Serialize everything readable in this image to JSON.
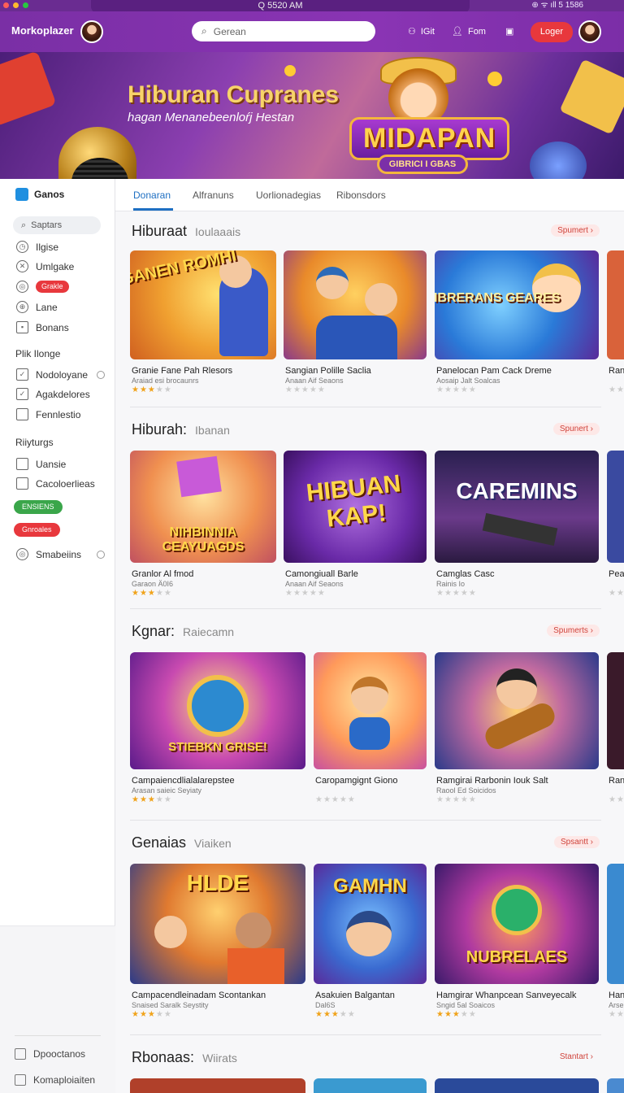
{
  "colors": {
    "brand_purple": "#7a2fa5",
    "accent_red": "#e8383d",
    "tab_blue": "#1e6fc2",
    "star": "#f0a31b"
  },
  "system": {
    "clock": "Q 5520 AM",
    "status": "⊕ ᯤ ıll 5 1586"
  },
  "header": {
    "brand": "Morkoplazer",
    "search_placeholder": "Gerean",
    "link_1": "IGit",
    "link_2": "Fom",
    "login": "Loger"
  },
  "hero": {
    "title": "Hiburan Cupranes",
    "subtitle": "hagan Menanebeenloŕj Hestan",
    "logo": "MIDAPAN",
    "badge": "GIBRICI I GBAS"
  },
  "sidebar": {
    "heading": "Ganos",
    "search": "Saptars",
    "items": [
      "Ilgise",
      "Umlgake",
      "Grakle",
      "Lane",
      "Bonans"
    ],
    "group_1": "Plik Ilonge",
    "group_1_items": [
      "Nodoloyane",
      "Agakdelores",
      "Fennlestio"
    ],
    "group_2": "Riiyturgs",
    "group_2_items": [
      "Uansie",
      "Cacoloerlieas"
    ],
    "pill_green": "ENSIENS",
    "pill_red": "Gnroales",
    "last_item": "Smabeiins",
    "footer": [
      "Dpooctanos",
      "Komaploiaiten"
    ]
  },
  "tabs": [
    "Donaran",
    "Alfranuns",
    "Uorlionadegias",
    "Ribonsdors"
  ],
  "sections": [
    {
      "title": "Hiburaat",
      "subtitle": "Ioulaaais",
      "more": "Spumert ›",
      "cards": [
        {
          "title": "Granie Fane Pah Rlesors",
          "sub": "Araiad esi brocaunrs",
          "stars": 3,
          "label": "GANEN ROMHI"
        },
        {
          "title": "Sangian Polille Saclia",
          "sub": "Anaan Aif Seaons",
          "stars": 0,
          "label": ""
        },
        {
          "title": "Panelocan Pam Cack Dreme",
          "sub": "Aosaip Jalt Soalcas",
          "stars": 0,
          "label": "HIBRERANS GEARES"
        },
        {
          "title": "Ran",
          "sub": "",
          "stars": 0,
          "label": ""
        }
      ]
    },
    {
      "title": "Hiburah:",
      "subtitle": "Ibanan",
      "more": "Spunert ›",
      "cards": [
        {
          "title": "Granlor Al fmod",
          "sub": "Garaon Ä0I6",
          "stars": 3,
          "label": "NIHBINNIA CEAYUAGDS"
        },
        {
          "title": "Camongiuall Barle",
          "sub": "Anaan Aif Seaons",
          "stars": 0,
          "label": "HIBUAN KAP!"
        },
        {
          "title": "Camglas Casc",
          "sub": "Rainis Io",
          "stars": 0,
          "label": "CAREMINS"
        },
        {
          "title": "Pea",
          "sub": "",
          "stars": 0,
          "label": ""
        }
      ]
    },
    {
      "title": "Kgnar:",
      "subtitle": "Raiecamn",
      "more": "Spumerts ›",
      "cards": [
        {
          "title": "Campaiencdlialalarepstee",
          "sub": "Arasan saieic Seyiaty",
          "stars": 3,
          "label": "STIEBKN GRISE!"
        },
        {
          "title": "Caropamgignt Giono",
          "sub": "",
          "stars": 0,
          "label": ""
        },
        {
          "title": "Ramgirai Rarbonin Iouk Salt",
          "sub": "Raool Ed Soicidos",
          "stars": 0,
          "label": ""
        },
        {
          "title": "Ran",
          "sub": "",
          "stars": 0,
          "label": ""
        }
      ]
    },
    {
      "title": "Genaias",
      "subtitle": "Viaiken",
      "more": "Spsantt ›",
      "cards": [
        {
          "title": "Campacendleinadam Scontankan",
          "sub": "Snaised Saralk Seystity",
          "stars": 3,
          "label": "HLDE"
        },
        {
          "title": "Asakuien Balgantan",
          "sub": "Dal6S",
          "stars": 3,
          "label": "GAMHN"
        },
        {
          "title": "Hamgirar Whanpcean Sanveyecalk",
          "sub": "Sngid 5al Soaicos",
          "stars": 3,
          "label": "NUBRELAES"
        },
        {
          "title": "Han",
          "sub": "Arse",
          "stars": 0,
          "label": ""
        }
      ]
    },
    {
      "title": "Rbonaas:",
      "subtitle": "Wiirats",
      "more": "Stantart ›",
      "cards": []
    }
  ]
}
